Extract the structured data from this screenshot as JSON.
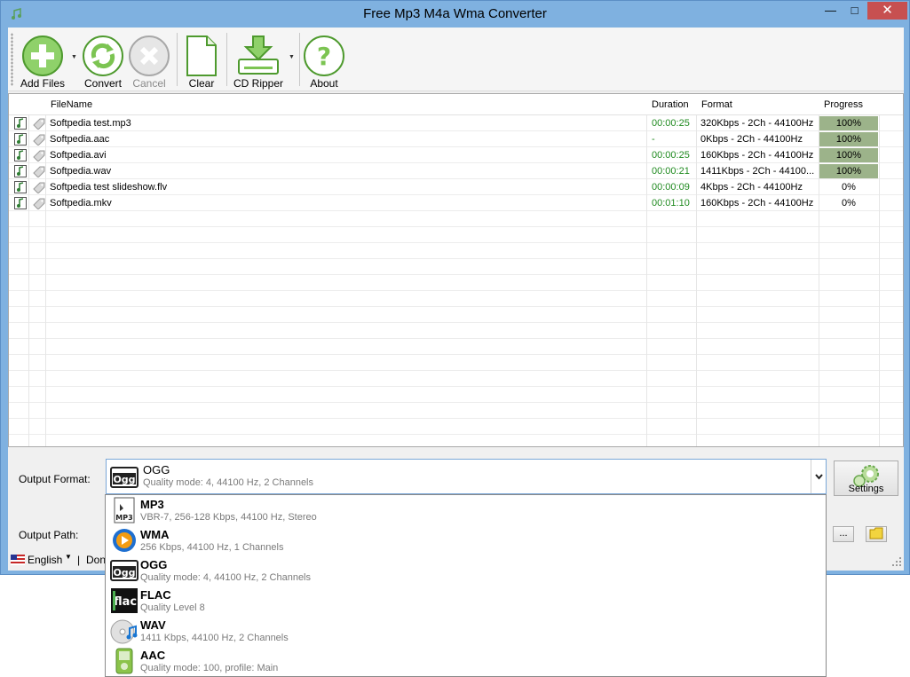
{
  "window": {
    "title": "Free Mp3 M4a Wma Converter",
    "minimize": "—",
    "maximize": "□",
    "close": "✕"
  },
  "toolbar": {
    "add_files": "Add Files",
    "convert": "Convert",
    "cancel": "Cancel",
    "clear": "Clear",
    "cd_ripper": "CD Ripper",
    "about": "About"
  },
  "list": {
    "columns": {
      "filename": "FileName",
      "duration": "Duration",
      "format": "Format",
      "progress": "Progress"
    },
    "rows": [
      {
        "name": "Softpedia test.mp3",
        "duration": "00:00:25",
        "format": "320Kbps - 2Ch - 44100Hz",
        "progress": "100%",
        "progress_value": 1.0
      },
      {
        "name": "Softpedia.aac",
        "duration": "-",
        "format": "0Kbps - 2Ch - 44100Hz",
        "progress": "100%",
        "progress_value": 1.0
      },
      {
        "name": "Softpedia.avi",
        "duration": "00:00:25",
        "format": "160Kbps - 2Ch - 44100Hz",
        "progress": "100%",
        "progress_value": 1.0
      },
      {
        "name": "Softpedia.wav",
        "duration": "00:00:21",
        "format": "1411Kbps - 2Ch - 44100...",
        "progress": "100%",
        "progress_value": 1.0
      },
      {
        "name": "Softpedia test slideshow.flv",
        "duration": "00:00:09",
        "format": "4Kbps - 2Ch - 44100Hz",
        "progress": "0%",
        "progress_value": 0.0
      },
      {
        "name": "Softpedia.mkv",
        "duration": "00:01:10",
        "format": "160Kbps - 2Ch - 44100Hz",
        "progress": "0%",
        "progress_value": 0.0
      }
    ]
  },
  "output": {
    "format_label": "Output Format:",
    "path_label": "Output Path:",
    "selected": {
      "name": "OGG",
      "desc": "Quality mode: 4, 44100 Hz, 2 Channels",
      "icon": "ogg-icon"
    },
    "settings": "Settings",
    "browse": "...",
    "options": [
      {
        "name": "MP3",
        "desc": "VBR-7, 256-128 Kbps, 44100 Hz, Stereo",
        "icon": "mp3-icon"
      },
      {
        "name": "WMA",
        "desc": "256 Kbps, 44100 Hz, 1 Channels",
        "icon": "wma-icon"
      },
      {
        "name": "OGG",
        "desc": "Quality mode: 4, 44100 Hz, 2 Channels",
        "icon": "ogg-icon"
      },
      {
        "name": "FLAC",
        "desc": "Quality Level 8",
        "icon": "flac-icon"
      },
      {
        "name": "WAV",
        "desc": "1411 Kbps, 44100 Hz, 2 Channels",
        "icon": "wav-icon"
      },
      {
        "name": "AAC",
        "desc": "Quality mode: 100, profile: Main",
        "icon": "aac-icon"
      }
    ]
  },
  "status": {
    "language": "English",
    "separator": "|",
    "text": "Don"
  },
  "colors": {
    "progress_fill": "#9cb38a",
    "duration_green": "#1f8a1f",
    "selection_border": "#7aa7d8"
  }
}
